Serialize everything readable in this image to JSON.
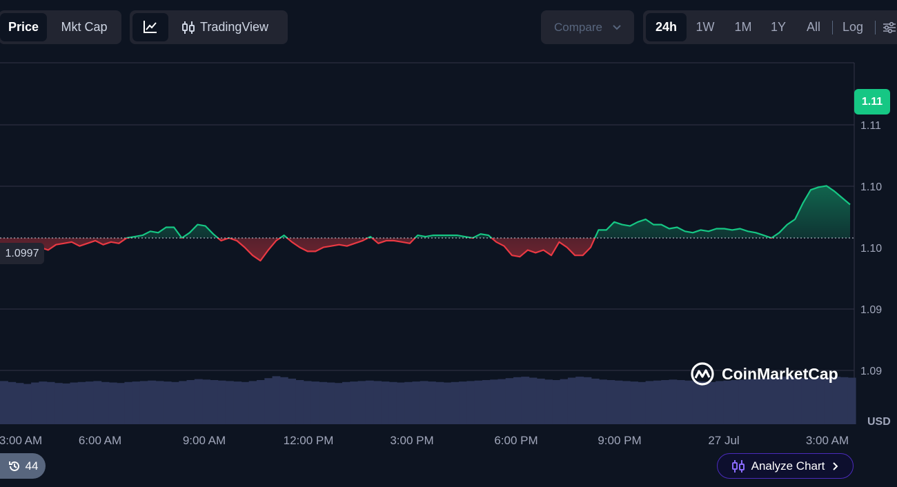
{
  "toolbar": {
    "price_label": "Price",
    "mktcap_label": "Mkt Cap",
    "tradingview_label": "TradingView",
    "compare_label": "Compare",
    "ranges": [
      "24h",
      "1W",
      "1M",
      "1Y",
      "All"
    ],
    "log_label": "Log"
  },
  "badges": {
    "current_price": "1.11",
    "reference_price": "1.0997"
  },
  "logo": {
    "text": "CoinMarketCap"
  },
  "currency_label": "USD",
  "history": {
    "count": "44"
  },
  "analyze": {
    "label": "Analyze Chart"
  },
  "colors": {
    "up": "#16c784",
    "down": "#ea3943",
    "volume": "#2c3557",
    "grid": "#323546",
    "background": "#0d1421",
    "accent_purple": "#6931ff"
  },
  "chart_data": {
    "type": "area",
    "x_tick_labels": [
      "3:00 AM",
      "6:00 AM",
      "9:00 AM",
      "12:00 PM",
      "3:00 PM",
      "6:00 PM",
      "9:00 PM",
      "27 Jul",
      "3:00 AM"
    ],
    "y_tick_labels": [
      "1.11",
      "1.10",
      "1.10",
      "1.09",
      "1.09"
    ],
    "ylim": [
      1.0898,
      1.1128
    ],
    "reference_value": 1.0997,
    "reference_label": "1.0997",
    "current_value": 1.1111,
    "current_label": "1.11",
    "hours_span": 24.7,
    "grid": true,
    "values": [
      1.0997,
      1.099,
      1.0987,
      1.0985,
      1.0984,
      1.0987,
      1.099,
      1.0988,
      1.0992,
      1.0993,
      1.0994,
      1.0991,
      1.0993,
      1.0995,
      1.0992,
      1.0994,
      1.0993,
      1.0997,
      1.0998,
      1.0999,
      1.1002,
      1.1001,
      1.1005,
      1.1005,
      1.0997,
      1.1001,
      1.1007,
      1.1006,
      1.1,
      1.0995,
      1.0997,
      1.0995,
      1.099,
      1.0984,
      1.098,
      1.0988,
      1.0995,
      1.0999,
      1.0994,
      1.099,
      1.0987,
      1.0987,
      1.099,
      1.0991,
      1.0992,
      1.0991,
      1.0993,
      1.0995,
      1.0998,
      1.0993,
      1.0995,
      1.0995,
      1.0994,
      1.0993,
      1.0999,
      1.0998,
      1.0999,
      1.0999,
      1.0999,
      1.0999,
      1.0998,
      1.0997,
      1.1,
      1.0999,
      1.0994,
      1.0991,
      1.0984,
      1.0983,
      1.0988,
      1.0986,
      1.0988,
      1.0984,
      1.0994,
      1.099,
      1.0984,
      1.0984,
      1.099,
      1.1003,
      1.1003,
      1.1009,
      1.1007,
      1.1006,
      1.1009,
      1.1011,
      1.1007,
      1.1007,
      1.1004,
      1.1005,
      1.1002,
      1.1001,
      1.1003,
      1.1002,
      1.1004,
      1.1004,
      1.1003,
      1.1004,
      1.1002,
      1.1001,
      1.0999,
      1.0997,
      1.1001,
      1.1007,
      1.1011,
      1.1023,
      1.1033,
      1.1035,
      1.1036,
      1.1032,
      1.1027,
      1.1022
    ]
  },
  "volume_data": {
    "values": [
      90,
      88,
      86,
      84,
      87,
      89,
      88,
      86,
      85,
      87,
      88,
      89,
      90,
      88,
      87,
      86,
      88,
      89,
      90,
      91,
      90,
      89,
      88,
      90,
      92,
      94,
      93,
      92,
      91,
      90,
      89,
      88,
      90,
      92,
      96,
      100,
      98,
      95,
      92,
      90,
      89,
      88,
      87,
      86,
      88,
      89,
      90,
      91,
      90,
      89,
      88,
      87,
      88,
      89,
      90,
      89,
      88,
      87,
      88,
      89,
      90,
      91,
      92,
      93,
      94,
      96,
      98,
      99,
      97,
      95,
      93,
      92,
      94,
      97,
      99,
      98,
      95,
      93,
      92,
      91,
      90,
      89,
      88,
      90,
      91,
      92,
      93,
      92,
      91,
      90,
      89,
      88,
      90,
      91,
      92,
      93,
      94,
      95,
      96,
      98,
      99,
      100,
      98,
      96,
      95,
      97,
      98,
      99,
      98,
      97
    ]
  }
}
